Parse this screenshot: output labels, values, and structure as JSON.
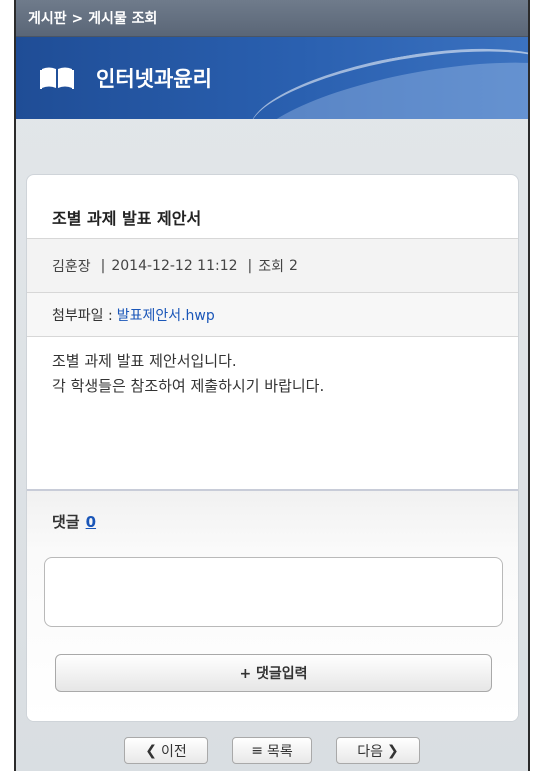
{
  "breadcrumb": "게시판 > 게시물 조회",
  "course_title": "인터넷과윤리",
  "post": {
    "title": "조별 과제 발표 제안서",
    "author": "김훈장",
    "date_sep": "|",
    "date": "2014-12-12 11:12",
    "views_sep": "|",
    "views_label": "조회",
    "views": "2",
    "attachment_label": "첨부파일 :",
    "attachment_name": "발표제안서.hwp",
    "body_line1": "조별 과제 발표 제안서입니다.",
    "body_line2": "각 학생들은 참조하여 제출하시기 바랍니다."
  },
  "comments": {
    "heading": "댓글",
    "count": "0",
    "textarea_value": "",
    "submit_label": "+ 댓글입력"
  },
  "pager": {
    "prev_label": "이전",
    "list_label": "목록",
    "next_label": "다음"
  },
  "icons": {
    "book": "book-icon",
    "prev": "chevron-left-icon",
    "list": "list-icon",
    "next": "chevron-right-icon"
  },
  "colors": {
    "header_blue": "#2a60b0",
    "link_blue": "#1a56b8"
  }
}
